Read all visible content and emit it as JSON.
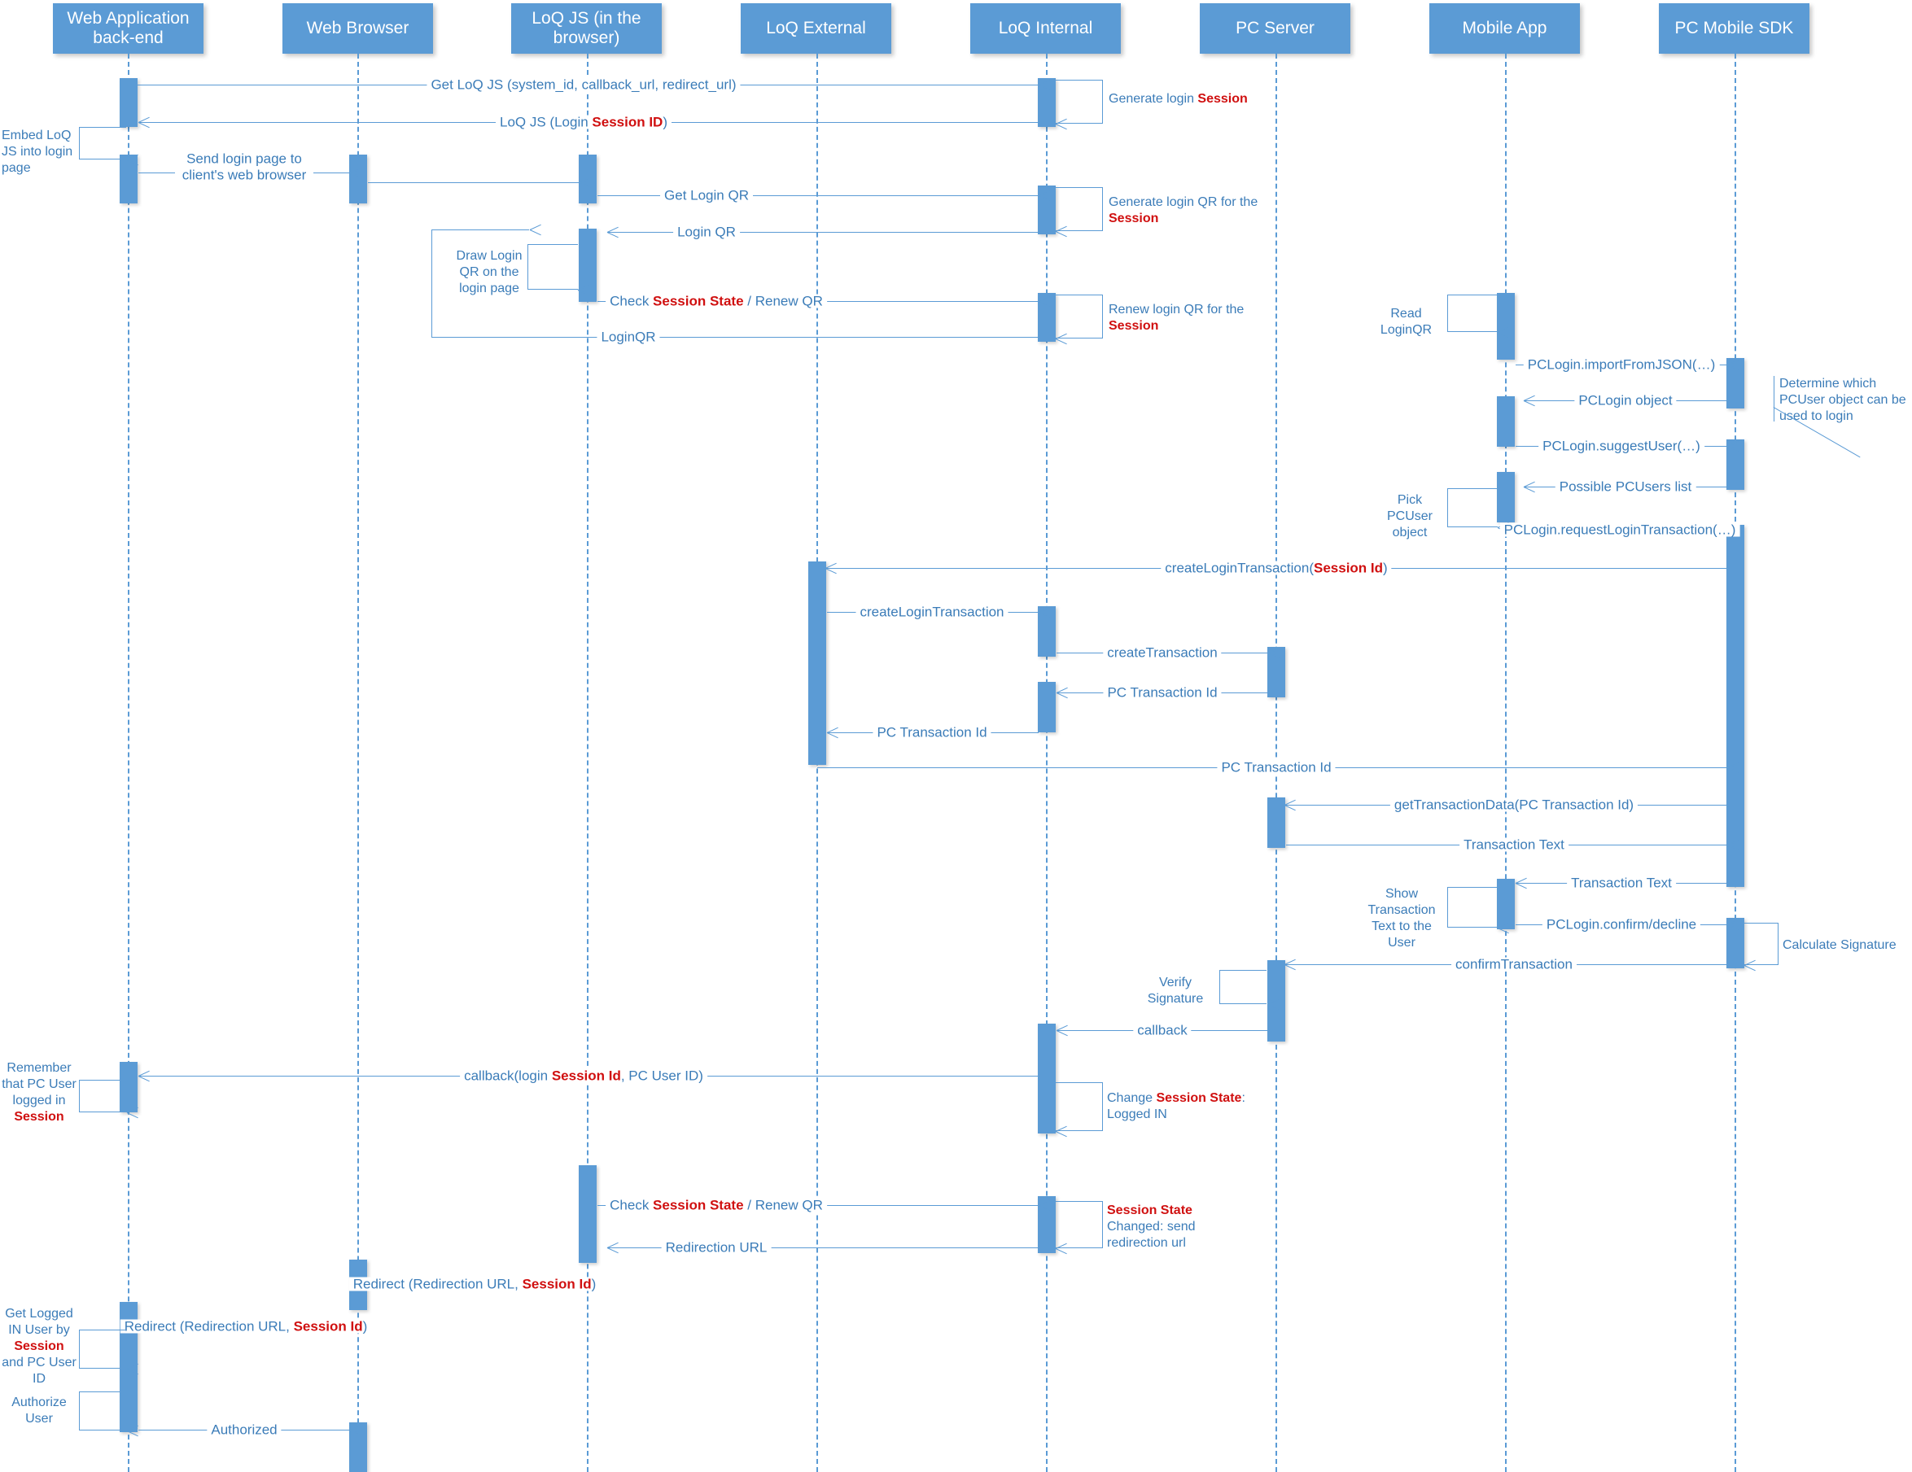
{
  "diagram": {
    "title": "LoQ Login Sequence Diagram",
    "colors": {
      "actor_fill": "#5b9bd5",
      "line": "#5b9bd5",
      "label_text": "#3b7cb8",
      "highlight_text": "#d01010",
      "background": "#ffffff"
    }
  },
  "lifelines": [
    {
      "id": "webapp",
      "label": "Web Application back-end"
    },
    {
      "id": "browser",
      "label": "Web Browser"
    },
    {
      "id": "loqjs",
      "label": "LoQ JS (in the browser)"
    },
    {
      "id": "loqext",
      "label": "LoQ External"
    },
    {
      "id": "loqint",
      "label": "LoQ Internal"
    },
    {
      "id": "pcserver",
      "label": "PC Server"
    },
    {
      "id": "mobile",
      "label": "Mobile App"
    },
    {
      "id": "pcsdk",
      "label": "PC Mobile SDK"
    }
  ],
  "messages": [
    {
      "id": "m01",
      "text": "Get LoQ JS (system_id, callback_url, redirect_url)",
      "from": "webapp",
      "to": "loqint",
      "dir": "right"
    },
    {
      "id": "m02",
      "text": "LoQ JS (Login ",
      "hl": "Session ID",
      "tail": ")",
      "from": "loqint",
      "to": "webapp",
      "dir": "left"
    },
    {
      "id": "m03",
      "text": "Send login page to client's web browser",
      "from": "webapp",
      "to": "browser",
      "dir": "right"
    },
    {
      "id": "m04",
      "text": "",
      "from": "browser",
      "to": "loqjs",
      "dir": "right"
    },
    {
      "id": "m05",
      "text": "Get Login QR",
      "from": "loqjs",
      "to": "loqint",
      "dir": "right"
    },
    {
      "id": "m06",
      "text": "Login QR",
      "from": "loqint",
      "to": "loqjs",
      "dir": "left"
    },
    {
      "id": "m07",
      "text": "Check ",
      "hl": "Session State",
      "tail": " / Renew QR",
      "from": "loqjs",
      "to": "loqint",
      "dir": "right"
    },
    {
      "id": "m08",
      "text": "LoginQR",
      "from": "loqint",
      "to": "loqjs",
      "dir": "left"
    },
    {
      "id": "m09",
      "text": "PCLogin.importFromJSON(…)",
      "from": "mobile",
      "to": "pcsdk",
      "dir": "right"
    },
    {
      "id": "m10",
      "text": "PCLogin object",
      "from": "pcsdk",
      "to": "mobile",
      "dir": "left"
    },
    {
      "id": "m11",
      "text": "PCLogin.suggestUser(…)",
      "from": "mobile",
      "to": "pcsdk",
      "dir": "right"
    },
    {
      "id": "m12",
      "text": "Possible PCUsers list",
      "from": "pcsdk",
      "to": "mobile",
      "dir": "left"
    },
    {
      "id": "m13",
      "text": "PCLogin.requestLoginTransaction(…)",
      "from": "mobile",
      "to": "pcsdk",
      "dir": "right"
    },
    {
      "id": "m14",
      "text": "createLoginTransaction(",
      "hl": "Session Id",
      "tail": ")",
      "from": "pcsdk",
      "to": "loqext",
      "dir": "left"
    },
    {
      "id": "m15",
      "text": "createLoginTransaction",
      "from": "loqext",
      "to": "loqint",
      "dir": "right"
    },
    {
      "id": "m16",
      "text": "createTransaction",
      "from": "loqint",
      "to": "pcserver",
      "dir": "right"
    },
    {
      "id": "m17",
      "text": "PC Transaction Id",
      "from": "pcserver",
      "to": "loqint",
      "dir": "left"
    },
    {
      "id": "m18",
      "text": "PC Transaction Id",
      "from": "loqint",
      "to": "loqext",
      "dir": "left"
    },
    {
      "id": "m19",
      "text": "PC Transaction Id",
      "from": "loqext",
      "to": "pcsdk",
      "dir": "right"
    },
    {
      "id": "m20",
      "text": "getTransactionData(PC Transaction Id)",
      "from": "pcsdk",
      "to": "pcserver",
      "dir": "left"
    },
    {
      "id": "m21",
      "text": "Transaction Text",
      "from": "pcserver",
      "to": "pcsdk",
      "dir": "right"
    },
    {
      "id": "m22",
      "text": "Transaction Text",
      "from": "pcsdk",
      "to": "mobile",
      "dir": "left"
    },
    {
      "id": "m23",
      "text": "PCLogin.confirm/decline",
      "from": "mobile",
      "to": "pcsdk",
      "dir": "right"
    },
    {
      "id": "m24",
      "text": "confirmTransaction",
      "from": "pcsdk",
      "to": "pcserver",
      "dir": "left"
    },
    {
      "id": "m25",
      "text": "callback",
      "from": "pcserver",
      "to": "loqint",
      "dir": "left"
    },
    {
      "id": "m26",
      "text": "callback(login ",
      "hl": "Session Id",
      "tail": ", PC User ID)",
      "from": "loqint",
      "to": "webapp",
      "dir": "left"
    },
    {
      "id": "m27",
      "text": "Check ",
      "hl": "Session State",
      "tail": " / Renew QR",
      "from": "loqjs",
      "to": "loqint",
      "dir": "right"
    },
    {
      "id": "m28",
      "text": "Redirection URL",
      "from": "loqint",
      "to": "loqjs",
      "dir": "left"
    },
    {
      "id": "m29",
      "text": "Redirect (Redirection URL, ",
      "hl": "Session Id",
      "tail": ")",
      "from": "loqjs",
      "to": "browser",
      "dir": "left"
    },
    {
      "id": "m30",
      "text": "Redirect (Redirection URL, ",
      "hl": "Session Id",
      "tail": ")",
      "from": "browser",
      "to": "webapp",
      "dir": "left"
    },
    {
      "id": "m31",
      "text": "Authorized",
      "from": "webapp",
      "to": "browser",
      "dir": "right"
    }
  ],
  "notes": [
    {
      "id": "n01",
      "text": "Generate login ",
      "hl": "Session",
      "tail": "",
      "anchor": "loqint"
    },
    {
      "id": "n02",
      "text": "Embed LoQ JS into login page",
      "anchor": "webapp"
    },
    {
      "id": "n03",
      "text": "Generate login QR for the ",
      "hl": "Session",
      "tail": "",
      "anchor": "loqint"
    },
    {
      "id": "n04",
      "text": "Draw Login QR on the login page",
      "anchor": "loqjs"
    },
    {
      "id": "n05",
      "text": "Renew login QR for the ",
      "hl": "Session",
      "tail": "",
      "anchor": "loqint"
    },
    {
      "id": "n06",
      "text": "Read LoginQR",
      "anchor": "mobile"
    },
    {
      "id": "n07",
      "text": "Determine which PCUser object can be used to login",
      "anchor": "pcsdk"
    },
    {
      "id": "n08",
      "text": "Pick PCUser object",
      "anchor": "mobile"
    },
    {
      "id": "n09",
      "text": "Show Transaction Text to the User",
      "anchor": "mobile"
    },
    {
      "id": "n10",
      "text": "Calculate Signature",
      "anchor": "pcsdk"
    },
    {
      "id": "n11",
      "text": "Verify Signature",
      "anchor": "pcserver"
    },
    {
      "id": "n12",
      "text": "Remember that PC User logged in ",
      "hl": "Session",
      "tail": "",
      "anchor": "webapp"
    },
    {
      "id": "n13",
      "text": "Change ",
      "hl": "Session State",
      "tail": ": Logged IN",
      "anchor": "loqint"
    },
    {
      "id": "n14",
      "text": "Session State",
      "hl": "",
      "tail": " Changed: send redirection url",
      "anchor": "loqint"
    },
    {
      "id": "n15",
      "text": "Get Logged IN User by ",
      "hl": "Session",
      "tail": " and PC User ID",
      "anchor": "webapp"
    },
    {
      "id": "n16",
      "text": "Authorize User",
      "anchor": "webapp"
    }
  ]
}
